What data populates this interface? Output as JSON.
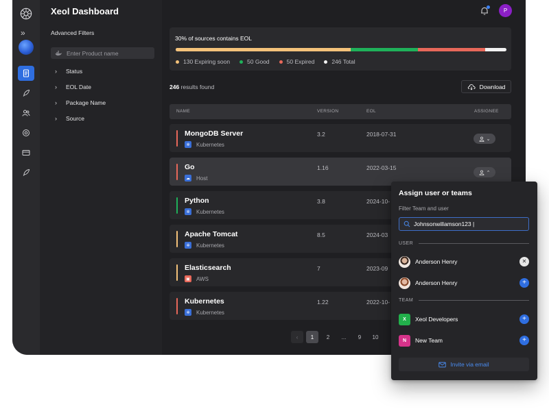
{
  "app": {
    "title": "Xeol Dashboard",
    "user_initial": "P"
  },
  "rail": {
    "expand_icon": "double-chevron-right-icon",
    "items": [
      {
        "icon": "document-icon",
        "active": true
      },
      {
        "icon": "rocket-icon",
        "active": false
      },
      {
        "icon": "users-icon",
        "active": false
      },
      {
        "icon": "target-icon",
        "active": false
      },
      {
        "icon": "card-icon",
        "active": false
      },
      {
        "icon": "rocket-icon",
        "active": false
      }
    ]
  },
  "filters": {
    "heading": "Advanced Filters",
    "product_placeholder": "Enter Product name",
    "items": [
      "Status",
      "EOL Date",
      "Package Name",
      "Source"
    ]
  },
  "summary": {
    "headline": "30% of sources contains EOL",
    "segments": [
      {
        "label": "130 Expiring soon",
        "value": 130,
        "color": "#f4c27a"
      },
      {
        "label": "50 Good",
        "value": 50,
        "color": "#1fb15a"
      },
      {
        "label": "50 Expired",
        "value": 50,
        "color": "#e8685a"
      },
      {
        "label": "246 Total",
        "value": 246,
        "color": "#f2f2f2"
      }
    ]
  },
  "results": {
    "count": "246",
    "suffix": " results found",
    "download_label": "Download"
  },
  "table": {
    "headers": {
      "name": "NAME",
      "version": "VERSION",
      "eol": "EOL",
      "assignee": "ASSIGNEE"
    },
    "rows": [
      {
        "name": "MongoDB Server",
        "platform": "Kubernetes",
        "platform_icon": "kubernetes-icon",
        "platform_color": "#3a6fd8",
        "version": "3.2",
        "eol": "2018-07-31",
        "accent": "#e8685a",
        "expanded": false
      },
      {
        "name": "Go",
        "platform": "Host",
        "platform_icon": "cloud-icon",
        "platform_color": "#3a6fd8",
        "version": "1.16",
        "eol": "2022-03-15",
        "accent": "#e8685a",
        "expanded": true
      },
      {
        "name": "Python",
        "platform": "Kubernetes",
        "platform_icon": "kubernetes-icon",
        "platform_color": "#3a6fd8",
        "version": "3.8",
        "eol": "2024-10-",
        "accent": "#1fb15a",
        "expanded": false
      },
      {
        "name": "Apache Tomcat",
        "platform": "Kubernetes",
        "platform_icon": "kubernetes-icon",
        "platform_color": "#3a6fd8",
        "version": "8.5",
        "eol": "2024-03",
        "accent": "#f4c27a",
        "expanded": false
      },
      {
        "name": "Elasticsearch",
        "platform": "AWS",
        "platform_icon": "aws-icon",
        "platform_color": "#e8685a",
        "version": "7",
        "eol": "2023-09",
        "accent": "#f4c27a",
        "expanded": false
      },
      {
        "name": "Kubernetes",
        "platform": "Kubernetes",
        "platform_icon": "kubernetes-icon",
        "platform_color": "#3a6fd8",
        "version": "1.22",
        "eol": "2022-10-",
        "accent": "#e8685a",
        "expanded": false
      }
    ]
  },
  "pagination": {
    "prev": "‹",
    "pages": [
      "1",
      "2",
      "...",
      "9",
      "10"
    ],
    "current": "1"
  },
  "assign_popup": {
    "title": "Assign user or teams",
    "filter_label": "Filter Team and user",
    "search_value": "Johnsonwillamson123 |",
    "user_section": "USER",
    "users": [
      {
        "name": "Anderson Henry",
        "action": "remove",
        "symbol": "✕"
      },
      {
        "name": "Anderson Henry",
        "action": "add",
        "symbol": "+"
      }
    ],
    "team_section": "TEAM",
    "teams": [
      {
        "initial": "X",
        "name": "Xeol Developers",
        "color": "#22b04b",
        "symbol": "+"
      },
      {
        "initial": "N",
        "name": "New Team",
        "color": "#d6338a",
        "symbol": "+"
      }
    ],
    "invite_label": "Invite via email"
  },
  "colors": {
    "accent_blue": "#2f6ee0",
    "background": "#1f1f22"
  }
}
